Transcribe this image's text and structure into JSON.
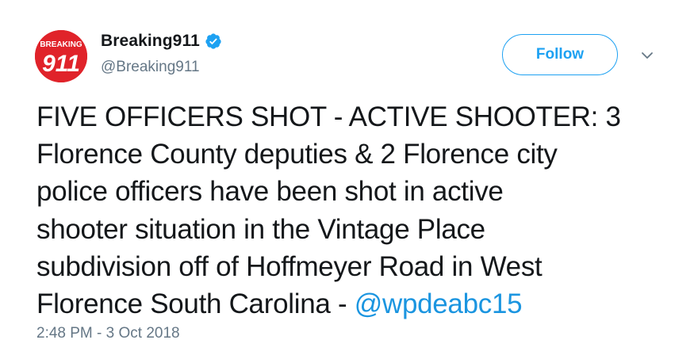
{
  "author": {
    "display_name": "Breaking911",
    "handle": "@Breaking911",
    "verified": true,
    "avatar_text_top": "BREAKING",
    "avatar_text_main": "911",
    "avatar_color": "#e0232a"
  },
  "actions": {
    "follow_label": "Follow"
  },
  "tweet": {
    "lines": [
      "FIVE OFFICERS SHOT - ACTIVE SHOOTER: 3",
      "Florence County deputies & 2 Florence city",
      "police officers have been shot in active",
      "shooter situation in the Vintage Place",
      "subdivision off of Hoffmeyer Road in West",
      "Florence South Carolina - "
    ],
    "mention": "@wpdeabc15",
    "timestamp": "2:48 PM - 3 Oct 2018"
  },
  "colors": {
    "accent": "#1da1f2",
    "link": "#1b95e0",
    "text": "#14171a",
    "secondary": "#657786"
  }
}
